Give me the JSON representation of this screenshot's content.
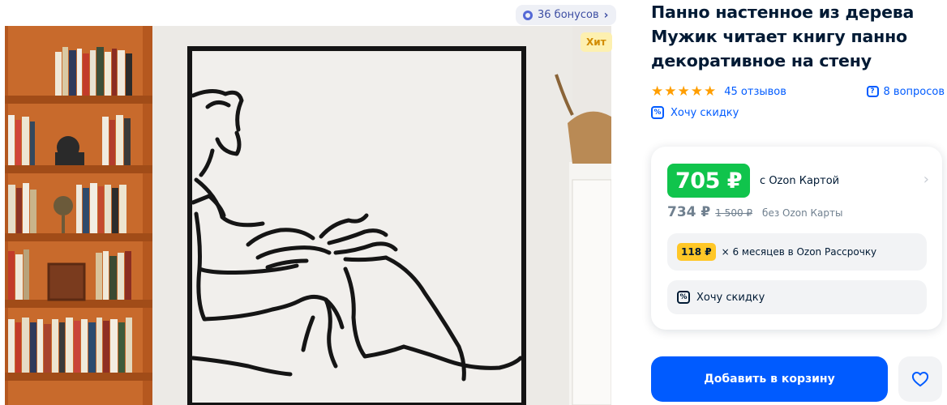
{
  "product": {
    "title": "Панно настенное из дерева Мужик читает книгу панно декоративное на стену"
  },
  "gallery": {
    "bonus_label": "36 бонусов",
    "badge_label": "Хит",
    "image_alt": "wooden-wall-panel-man-reading"
  },
  "rating": {
    "stars": 5,
    "reviews_label": "45 отзывов",
    "questions_label": "8 вопросов"
  },
  "discount_link": {
    "label": "Хочу скидку"
  },
  "price": {
    "card_price": "705 ₽",
    "card_note": "с Ozon Картой",
    "regular_price": "734 ₽",
    "old_price": "1 500 ₽",
    "regular_note": "без Ozon Карты",
    "installment_amount": "118 ₽",
    "installment_text": "× 6 месяцев в Ozon Рассрочку",
    "want_discount_label": "Хочу скидку"
  },
  "actions": {
    "add_to_cart_label": "Добавить в корзину"
  },
  "colors": {
    "accent_blue": "#005bff",
    "price_green": "#10c44c",
    "star_orange": "#ff9e00",
    "installment_yellow": "#ffc727",
    "hit_badge_bg": "#fdf0b0"
  },
  "icons": [
    "bonus-icon",
    "chevron-right-icon",
    "star-icon",
    "question-icon",
    "percent-icon",
    "heart-icon"
  ]
}
